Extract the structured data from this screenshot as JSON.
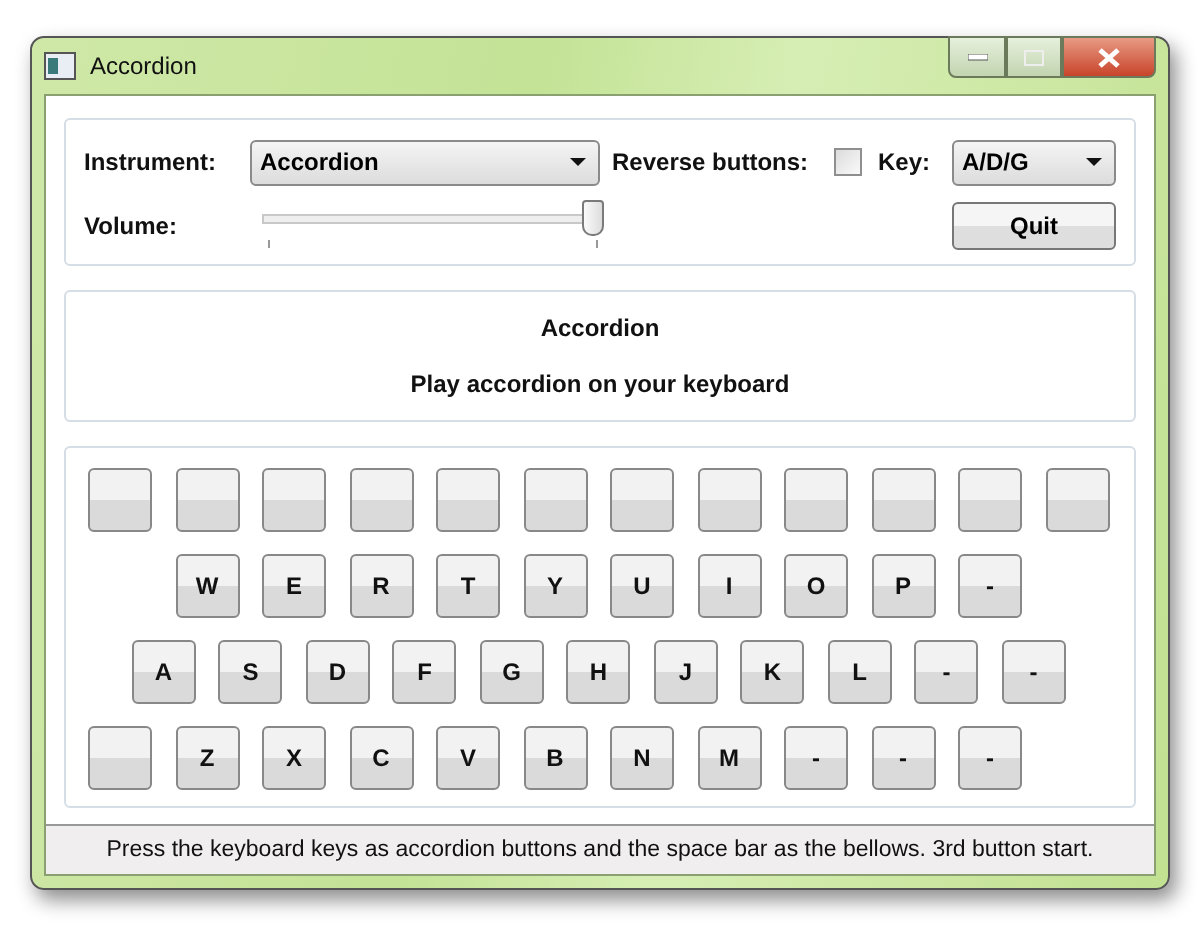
{
  "window": {
    "title": "Accordion"
  },
  "controls": {
    "instrument_label": "Instrument:",
    "instrument": "Accordion",
    "reverse_label": "Reverse buttons:",
    "reverse_checked": false,
    "key_label": "Key:",
    "key": "A/D/G",
    "volume_label": "Volume:",
    "volume": {
      "level": 1
    },
    "quit": "Quit"
  },
  "message": {
    "title": "Accordion",
    "text": "Play accordion on your keyboard"
  },
  "keyboard": [
    [
      {
        "kind": "blank"
      },
      {
        "kind": "blank"
      },
      {
        "kind": "blank"
      },
      {
        "kind": "blank"
      },
      {
        "kind": "blank"
      },
      {
        "kind": "blank"
      },
      {
        "kind": "blank"
      },
      {
        "kind": "blank"
      },
      {
        "kind": "blank"
      },
      {
        "kind": "blank"
      },
      {
        "kind": "blank"
      },
      {
        "kind": "blank"
      }
    ],
    [
      {
        "kind": "key",
        "label": "W"
      },
      {
        "kind": "key",
        "label": "E"
      },
      {
        "kind": "key",
        "label": "R"
      },
      {
        "kind": "key",
        "label": "T"
      },
      {
        "kind": "key",
        "label": "Y"
      },
      {
        "kind": "key",
        "label": "U"
      },
      {
        "kind": "key",
        "label": "I"
      },
      {
        "kind": "key",
        "label": "O"
      },
      {
        "kind": "key",
        "label": "P"
      },
      {
        "kind": "key",
        "label": "-"
      }
    ],
    [
      {
        "kind": "key",
        "label": "A"
      },
      {
        "kind": "key",
        "label": "S"
      },
      {
        "kind": "key",
        "label": "D"
      },
      {
        "kind": "key",
        "label": "F"
      },
      {
        "kind": "key",
        "label": "G"
      },
      {
        "kind": "key",
        "label": "H"
      },
      {
        "kind": "key",
        "label": "J"
      },
      {
        "kind": "key",
        "label": "K"
      },
      {
        "kind": "key",
        "label": "L"
      },
      {
        "kind": "key",
        "label": "-"
      },
      {
        "kind": "key",
        "label": "-"
      }
    ],
    [
      {
        "kind": "blank"
      },
      {
        "kind": "key",
        "label": "Z"
      },
      {
        "kind": "key",
        "label": "X"
      },
      {
        "kind": "key",
        "label": "C"
      },
      {
        "kind": "key",
        "label": "V"
      },
      {
        "kind": "key",
        "label": "B"
      },
      {
        "kind": "key",
        "label": "N"
      },
      {
        "kind": "key",
        "label": "M"
      },
      {
        "kind": "key",
        "label": "-"
      },
      {
        "kind": "key",
        "label": "-"
      },
      {
        "kind": "key",
        "label": "-"
      }
    ]
  ],
  "status_bar": "Press the keyboard keys as accordion buttons and the space bar as the bellows. 3rd button start."
}
